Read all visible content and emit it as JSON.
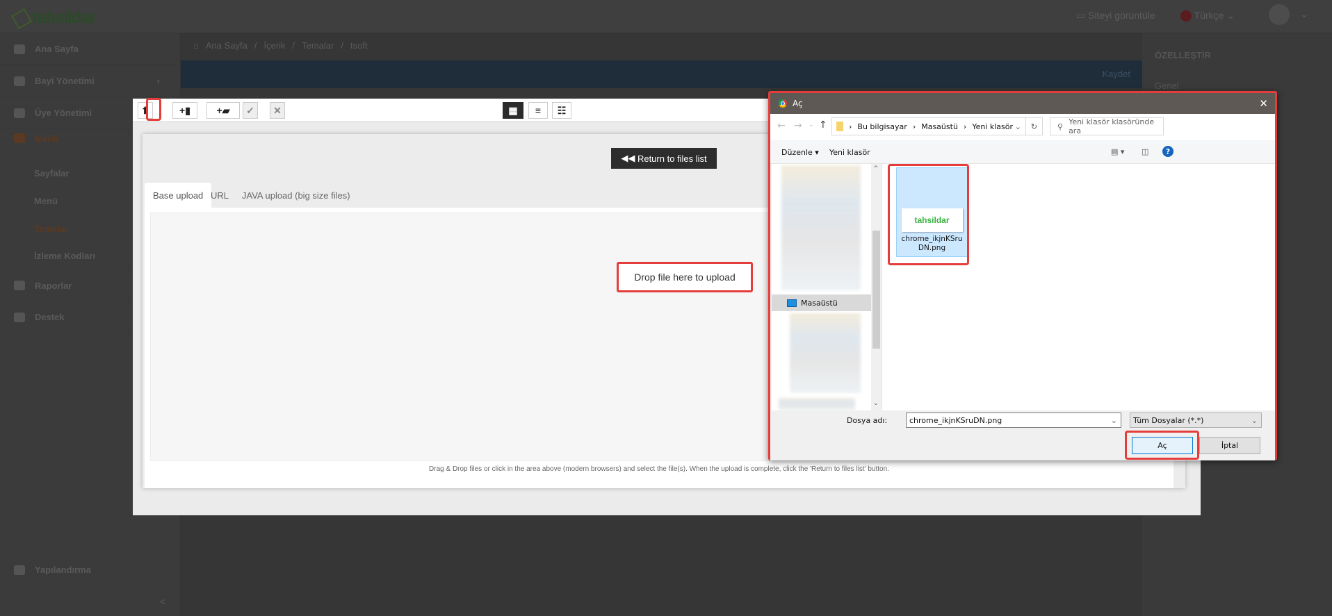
{
  "header": {
    "logo_text": "tahsildar",
    "view_site": "Siteyi görüntüle",
    "language": "Türkçe"
  },
  "sidebar": {
    "items": [
      {
        "label": "Ana Sayfa",
        "icon": "home-icon"
      },
      {
        "label": "Bayi Yönetimi",
        "icon": "user-icon"
      },
      {
        "label": "Üye Yönetimi",
        "icon": "user-icon"
      },
      {
        "label": "İçerik",
        "icon": "pen-icon"
      },
      {
        "label": "Raporlar",
        "icon": "chart-icon"
      },
      {
        "label": "Destek",
        "icon": "chat-icon"
      },
      {
        "label": "Yapılandırma",
        "icon": "gear-icon"
      }
    ],
    "subitems": [
      "Sayfalar",
      "Menü",
      "Temalar",
      "İzleme Kodları"
    ],
    "active": "Temalar",
    "collapse": "<"
  },
  "breadcrumb": [
    "Ana Sayfa",
    "İçerik",
    "Temalar",
    "tsoft"
  ],
  "bluebar": {
    "save": "Kaydet"
  },
  "rightpanel": {
    "title": "ÖZELLEŞTİR",
    "section": "Genel"
  },
  "filemanager": {
    "return_button": "Return to files list",
    "tabs": [
      "Base upload",
      "URL",
      "JAVA upload (big size files)"
    ],
    "drop_text": "Drop file here to upload",
    "hint": "Drag & Drop files or click in the area above (modern browsers) and select the file(s). When the upload is complete, click the 'Return to files list' button."
  },
  "dialog": {
    "title": "Aç",
    "path": [
      "Bu bilgisayar",
      "Masaüstü",
      "Yeni klasör"
    ],
    "search_placeholder": "Yeni klasör klasöründe ara",
    "organize": "Düzenle",
    "new_folder": "Yeni klasör",
    "nav_selected": "Masaüstü",
    "file": {
      "name": "chrome_ikjnKSruDN.png",
      "thumb_text": "tahsildar"
    },
    "filename_label": "Dosya adı:",
    "filename_value": "chrome_ikjnKSruDN.png",
    "filter": "Tüm Dosyalar (*.*)",
    "open": "Aç",
    "cancel": "İptal"
  },
  "colors": {
    "highlight": "#e53c3c",
    "header_bar": "#1f2d3a",
    "selection": "#cce8ff"
  }
}
